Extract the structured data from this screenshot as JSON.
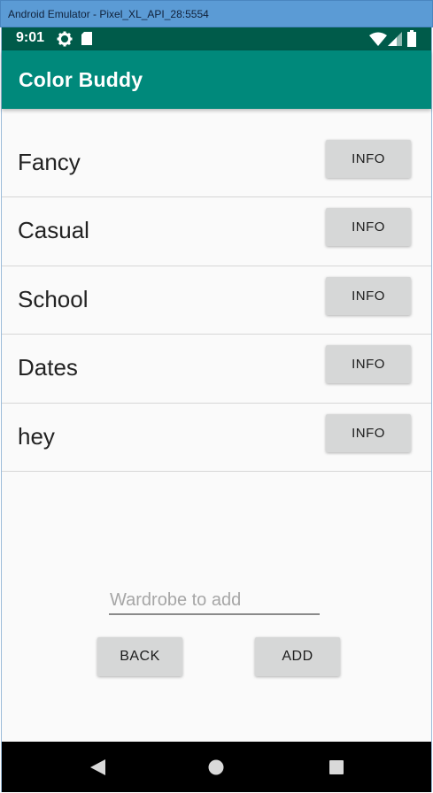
{
  "window": {
    "title": "Android Emulator - Pixel_XL_API_28:5554"
  },
  "status_bar": {
    "time": "9:01",
    "icons": [
      "settings-gear-icon",
      "sd-card-icon",
      "wifi-icon",
      "cell-signal-icon",
      "battery-icon"
    ]
  },
  "app_bar": {
    "title": "Color Buddy"
  },
  "wardrobes": [
    {
      "label": "Fancy",
      "button": "INFO"
    },
    {
      "label": "Casual",
      "button": "INFO"
    },
    {
      "label": "School",
      "button": "INFO"
    },
    {
      "label": "Dates",
      "button": "INFO"
    },
    {
      "label": "hey",
      "button": "INFO"
    }
  ],
  "input": {
    "placeholder": "Wardrobe to add",
    "value": ""
  },
  "buttons": {
    "back": "BACK",
    "add": "ADD"
  },
  "colors": {
    "status_bar": "#005b4a",
    "app_bar": "#00897b",
    "button_bg": "#d6d7d7",
    "nav_bar": "#000000"
  }
}
